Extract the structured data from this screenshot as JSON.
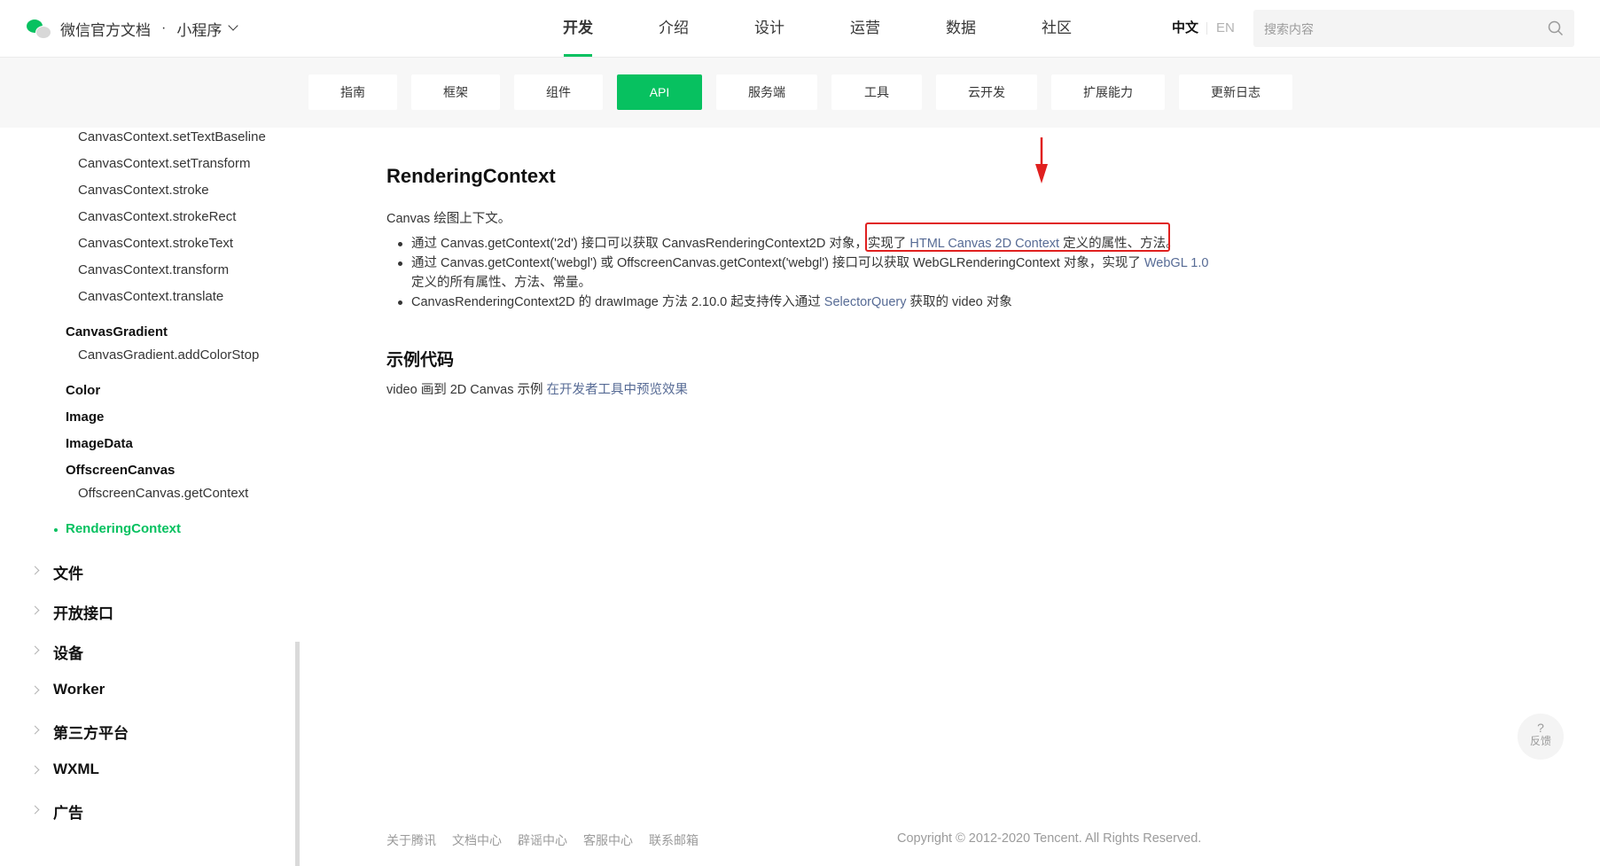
{
  "header": {
    "brand_title": "微信官方文档",
    "brand_dot": "·",
    "product": "小程序",
    "nav": [
      "开发",
      "介绍",
      "设计",
      "运营",
      "数据",
      "社区"
    ],
    "active_nav": "开发",
    "lang_zh": "中文",
    "lang_en": "EN",
    "search_placeholder": "搜索内容"
  },
  "subnav": {
    "tabs": [
      "指南",
      "框架",
      "组件",
      "API",
      "服务端",
      "工具",
      "云开发",
      "扩展能力",
      "更新日志"
    ],
    "active": "API"
  },
  "sidebar": {
    "canvas_context_items": [
      "CanvasContext.setTextBaseline",
      "CanvasContext.setTransform",
      "CanvasContext.stroke",
      "CanvasContext.strokeRect",
      "CanvasContext.strokeText",
      "CanvasContext.transform",
      "CanvasContext.translate"
    ],
    "canvas_gradient": "CanvasGradient",
    "canvas_gradient_items": [
      "CanvasGradient.addColorStop"
    ],
    "color": "Color",
    "image": "Image",
    "image_data": "ImageData",
    "offscreen_canvas": "OffscreenCanvas",
    "offscreen_items": [
      "OffscreenCanvas.getContext"
    ],
    "rendering_context": "RenderingContext",
    "sections": [
      "文件",
      "开放接口",
      "设备",
      "Worker",
      "第三方平台",
      "WXML",
      "广告"
    ]
  },
  "content": {
    "title": "RenderingContext",
    "desc": "Canvas 绘图上下文。",
    "b1_a": "通过 Canvas.getContext('2d') 接口可以获取 CanvasRenderingContext2D 对象，",
    "b1_b": "实现了 ",
    "b1_link": "HTML Canvas 2D Context",
    "b1_c": " 定义的属性、方法。",
    "b2_a": "通过 Canvas.getContext('webgl') 或 OffscreenCanvas.getContext('webgl') 接口可以获取 WebGLRenderingContext 对象，实现了 ",
    "b2_link": "WebGL 1.0",
    "b2_b": " 定义的所有属性、方法、常量。",
    "b3_a": "CanvasRenderingContext2D 的 drawImage 方法 2.10.0 起支持传入通过 ",
    "b3_link": "SelectorQuery",
    "b3_b": " 获取的 video 对象",
    "example_title": "示例代码",
    "example_text": "video 画到 2D Canvas 示例 ",
    "example_link": "在开发者工具中预览效果"
  },
  "footer": {
    "links": [
      "关于腾讯",
      "文档中心",
      "辟谣中心",
      "客服中心",
      "联系邮箱"
    ],
    "copyright": "Copyright © 2012-2020 Tencent. All Rights Reserved."
  },
  "feedback": {
    "icon": "?",
    "label": "反馈"
  },
  "colors": {
    "brand_green": "#07c160",
    "link": "#576b95",
    "annotation_red": "#e0201f"
  }
}
